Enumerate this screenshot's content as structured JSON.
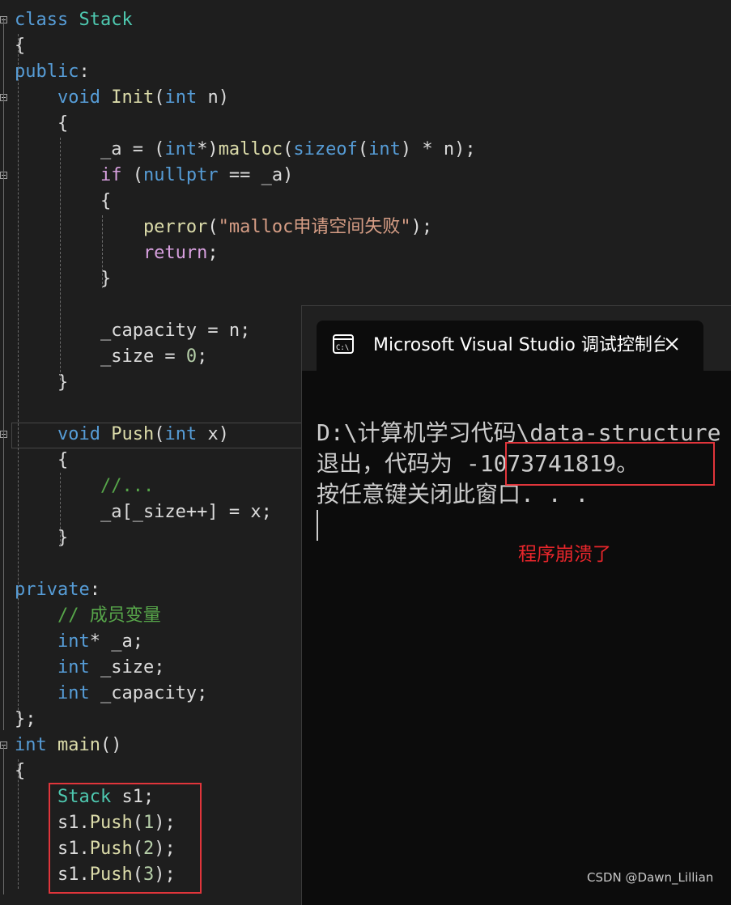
{
  "editor": {
    "lines": [
      {
        "tokens": [
          {
            "t": "class ",
            "c": "kw"
          },
          {
            "t": "Stack",
            "c": "typ"
          }
        ]
      },
      {
        "tokens": [
          {
            "t": "{",
            "c": ""
          }
        ]
      },
      {
        "tokens": [
          {
            "t": "public",
            "c": "kw"
          },
          {
            "t": ":",
            "c": ""
          }
        ]
      },
      {
        "tokens": [
          {
            "t": "    void ",
            "c": "kw"
          },
          {
            "t": "Init",
            "c": "fn"
          },
          {
            "t": "(",
            "c": ""
          },
          {
            "t": "int",
            "c": "kw"
          },
          {
            "t": " n)",
            "c": "var"
          }
        ]
      },
      {
        "tokens": [
          {
            "t": "    {",
            "c": ""
          }
        ]
      },
      {
        "tokens": [
          {
            "t": "        _a = (",
            "c": "var"
          },
          {
            "t": "int",
            "c": "kw"
          },
          {
            "t": "*)",
            "c": ""
          },
          {
            "t": "malloc",
            "c": "fn"
          },
          {
            "t": "(",
            "c": ""
          },
          {
            "t": "sizeof",
            "c": "kw"
          },
          {
            "t": "(",
            "c": ""
          },
          {
            "t": "int",
            "c": "kw"
          },
          {
            "t": ") * n);",
            "c": ""
          }
        ]
      },
      {
        "tokens": [
          {
            "t": "        if ",
            "c": "ret"
          },
          {
            "t": "(",
            "c": ""
          },
          {
            "t": "nullptr",
            "c": "kw"
          },
          {
            "t": " == _a)",
            "c": ""
          }
        ]
      },
      {
        "tokens": [
          {
            "t": "        {",
            "c": ""
          }
        ]
      },
      {
        "tokens": [
          {
            "t": "            perror",
            "c": "fn"
          },
          {
            "t": "(",
            "c": ""
          },
          {
            "t": "\"malloc申请空间失败\"",
            "c": "str"
          },
          {
            "t": ");",
            "c": ""
          }
        ]
      },
      {
        "tokens": [
          {
            "t": "            return",
            "c": "ret"
          },
          {
            "t": ";",
            "c": ""
          }
        ]
      },
      {
        "tokens": [
          {
            "t": "        }",
            "c": ""
          }
        ]
      },
      {
        "tokens": [
          {
            "t": "",
            "c": ""
          }
        ]
      },
      {
        "tokens": [
          {
            "t": "        _capacity = n;",
            "c": ""
          }
        ]
      },
      {
        "tokens": [
          {
            "t": "        _size = ",
            "c": ""
          },
          {
            "t": "0",
            "c": "num"
          },
          {
            "t": ";",
            "c": ""
          }
        ]
      },
      {
        "tokens": [
          {
            "t": "    }",
            "c": ""
          }
        ]
      },
      {
        "tokens": [
          {
            "t": "",
            "c": ""
          }
        ]
      },
      {
        "tokens": [
          {
            "t": "    void ",
            "c": "kw"
          },
          {
            "t": "Push",
            "c": "fn"
          },
          {
            "t": "(",
            "c": ""
          },
          {
            "t": "int",
            "c": "kw"
          },
          {
            "t": " x)",
            "c": ""
          }
        ]
      },
      {
        "tokens": [
          {
            "t": "    {",
            "c": ""
          }
        ]
      },
      {
        "tokens": [
          {
            "t": "        //...",
            "c": "cm"
          }
        ]
      },
      {
        "tokens": [
          {
            "t": "        _a[_size++] = x;",
            "c": ""
          }
        ]
      },
      {
        "tokens": [
          {
            "t": "    }",
            "c": ""
          }
        ]
      },
      {
        "tokens": [
          {
            "t": "",
            "c": ""
          }
        ]
      },
      {
        "tokens": [
          {
            "t": "private",
            "c": "kw"
          },
          {
            "t": ":",
            "c": ""
          }
        ]
      },
      {
        "tokens": [
          {
            "t": "    // 成员变量",
            "c": "cm"
          }
        ]
      },
      {
        "tokens": [
          {
            "t": "    int",
            "c": "kw"
          },
          {
            "t": "* _a;",
            "c": ""
          }
        ]
      },
      {
        "tokens": [
          {
            "t": "    int",
            "c": "kw"
          },
          {
            "t": " _size;",
            "c": ""
          }
        ]
      },
      {
        "tokens": [
          {
            "t": "    int",
            "c": "kw"
          },
          {
            "t": " _capacity;",
            "c": ""
          }
        ]
      },
      {
        "tokens": [
          {
            "t": "};",
            "c": ""
          }
        ]
      },
      {
        "tokens": [
          {
            "t": "int ",
            "c": "kw"
          },
          {
            "t": "main",
            "c": "fn"
          },
          {
            "t": "()",
            "c": ""
          }
        ]
      },
      {
        "tokens": [
          {
            "t": "{",
            "c": ""
          }
        ]
      },
      {
        "tokens": [
          {
            "t": "    Stack",
            "c": "typ"
          },
          {
            "t": " s1;",
            "c": ""
          }
        ]
      },
      {
        "tokens": [
          {
            "t": "    s1.",
            "c": ""
          },
          {
            "t": "Push",
            "c": "fn"
          },
          {
            "t": "(",
            "c": ""
          },
          {
            "t": "1",
            "c": "num"
          },
          {
            "t": ");",
            "c": ""
          }
        ]
      },
      {
        "tokens": [
          {
            "t": "    s1.",
            "c": ""
          },
          {
            "t": "Push",
            "c": "fn"
          },
          {
            "t": "(",
            "c": ""
          },
          {
            "t": "2",
            "c": "num"
          },
          {
            "t": ");",
            "c": ""
          }
        ]
      },
      {
        "tokens": [
          {
            "t": "    s1.",
            "c": ""
          },
          {
            "t": "Push",
            "c": "fn"
          },
          {
            "t": "(",
            "c": ""
          },
          {
            "t": "3",
            "c": "num"
          },
          {
            "t": ");",
            "c": ""
          }
        ]
      }
    ]
  },
  "console": {
    "title": "Microsoft Visual Studio 调试控制台",
    "lines": [
      "D:\\计算机学习代码\\data-structure",
      "退出，代码为 -1073741819。",
      "按任意键关闭此窗口. . ."
    ]
  },
  "annotation": "程序崩溃了",
  "watermark": "CSDN @Dawn_Lillian",
  "colors": {
    "highlight_box": "#e0353b",
    "annotation": "#e8262b"
  }
}
